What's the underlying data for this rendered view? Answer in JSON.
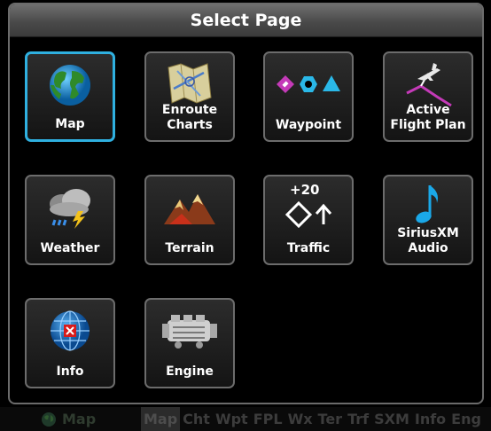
{
  "window": {
    "title": "Select Page"
  },
  "tiles": [
    {
      "label": "Map",
      "icon": "globe-icon",
      "selected": true
    },
    {
      "label": "Enroute Charts",
      "icon": "chart-icon"
    },
    {
      "label": "Waypoint",
      "icon": "waypoint-symbols-icon"
    },
    {
      "label": "Active Flight Plan",
      "icon": "flight-plan-icon"
    },
    {
      "label": "Weather",
      "icon": "weather-cloud-icon"
    },
    {
      "label": "Terrain",
      "icon": "terrain-mountain-icon"
    },
    {
      "label": "Traffic",
      "icon": "traffic-symbol-icon",
      "icon_text": "+20"
    },
    {
      "label": "SiriusXM Audio",
      "icon": "music-note-icon"
    },
    {
      "label": "Info",
      "icon": "info-globe-icon"
    },
    {
      "label": "Engine",
      "icon": "engine-icon"
    }
  ],
  "bottom_bar": {
    "current_page": "Map",
    "current_icon": "globe-icon",
    "tabs": [
      "Map",
      "Cht",
      "Wpt",
      "FPL",
      "Wx",
      "Ter",
      "Trf",
      "SXM",
      "Info",
      "Eng"
    ],
    "active_tab": "Map"
  },
  "colors": {
    "selection": "#2fb0e0",
    "tile_border": "#6c6c6c",
    "title_bar": "#5a5a5a"
  }
}
